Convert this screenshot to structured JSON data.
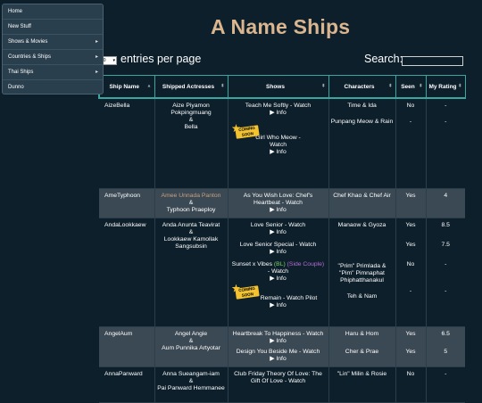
{
  "sidebar": {
    "items": [
      {
        "label": "Home",
        "arrow": ""
      },
      {
        "label": "New Stuff",
        "arrow": ""
      },
      {
        "label": "Shows & Movies",
        "arrow": "▸"
      },
      {
        "label": "Countries & Ships",
        "arrow": "▸"
      },
      {
        "label": "Thai Ships",
        "arrow": "▸"
      },
      {
        "label": "Dunno",
        "arrow": ""
      }
    ]
  },
  "page": {
    "title": "A Name Ships"
  },
  "controls": {
    "length_value": "50",
    "length_label": "entries per page",
    "search_label": "Search:",
    "search_value": ""
  },
  "table": {
    "headers": [
      {
        "label": "Ship Name",
        "sort": "▲"
      },
      {
        "label": "Shipped Actresses",
        "sort": "⬍"
      },
      {
        "label": "Shows",
        "sort": "⬍"
      },
      {
        "label": "Characters",
        "sort": "⬍"
      },
      {
        "label": "Seen",
        "sort": "⬍"
      },
      {
        "label": "My Rating",
        "sort": "⬍"
      }
    ],
    "rows": {
      "aizebella": {
        "ship": "AizeBella",
        "actress1": "Aize Piyamon Pokpingmuang",
        "amp": "&",
        "actress2": "Bella",
        "show1": "Teach Me Softly",
        "show2": "Girl Who Meow",
        "char1": "Time & Ida",
        "char2": "Punpang Meow & Rain",
        "seen1": "No",
        "seen2": "-",
        "rate1": "-",
        "rate2": "-"
      },
      "ametyphoon": {
        "ship": "AmeTyphoon",
        "actress1": "Amee Unnada Panton",
        "amp": "&",
        "actress2": "Typhoon Praeploy",
        "show1": "As You Wish Love: Chef's Heartbeat",
        "char1": "Chef Khao & Chef Air",
        "seen1": "Yes",
        "rate1": "4"
      },
      "andalookkaew": {
        "ship": "AndaLookkaew",
        "actress1": "Anda Anunta Teavirat",
        "amp": "&",
        "actress2": "Lookkaew Kamollak Sangsubsin",
        "show1": "Love Senior",
        "show2": "Love Senior Special",
        "show3a": "Sunset x Vibes",
        "show3b": "(BL)",
        "show3c": "(Side Couple)",
        "show4": "Remain",
        "show4b": "Watch Pilot",
        "char1": "Manaow & Gyoza",
        "char3": "\"Prim\" Primlada & \"Pim\" Pimnaphat Phiphatthanakul",
        "char4": "Teh & Nam",
        "seen1": "Yes",
        "seen2": "Yes",
        "seen3": "No",
        "seen4": "-",
        "rate1": "8.5",
        "rate2": "7.5",
        "rate3": "-",
        "rate4": "-"
      },
      "angelaum": {
        "ship": "AngelAum",
        "actress1": "Angel Angie",
        "amp": "&",
        "actress2": "Aum Punnika Artyotar",
        "show1": "Heartbreak To Happiness",
        "show2": "Design You Beside Me",
        "char1": "Haru & Hom",
        "char2": "Cher & Prae",
        "seen1": "Yes",
        "seen2": "Yes",
        "rate1": "6.5",
        "rate2": "5"
      },
      "annapanward": {
        "ship": "AnnaPanward",
        "actress1": "Anna Sueangam-iam",
        "amp": "&",
        "actress2": "Pai Panward Hemmanee",
        "show1": "Club Friday Theory Of Love: The Gift Of Love",
        "char1": "\"Lin\" Milin & Rosie",
        "seen1": "No",
        "rate1": "-"
      }
    },
    "watch": "Watch",
    "info": "▶ Info",
    "dash": " - ",
    "coming_soon": "COMING SOON"
  }
}
